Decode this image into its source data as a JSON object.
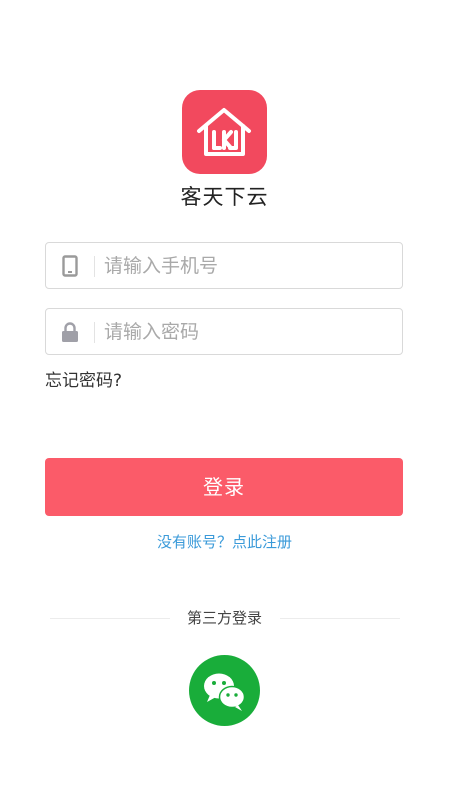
{
  "app": {
    "name": "客天下云",
    "logo_icon": "house-logo-icon",
    "brand_color": "#f2495e"
  },
  "form": {
    "phone_placeholder": "请输入手机号",
    "phone_icon": "phone-icon",
    "password_placeholder": "请输入密码",
    "password_icon": "lock-icon",
    "forgot_label": "忘记密码?"
  },
  "actions": {
    "login_label": "登录",
    "login_color": "#fb5b69",
    "register_label": "没有账号？点此注册",
    "register_color": "#3a9ad9"
  },
  "third_party": {
    "label": "第三方登录",
    "wechat_icon": "wechat-icon",
    "wechat_color": "#19ad3a"
  }
}
